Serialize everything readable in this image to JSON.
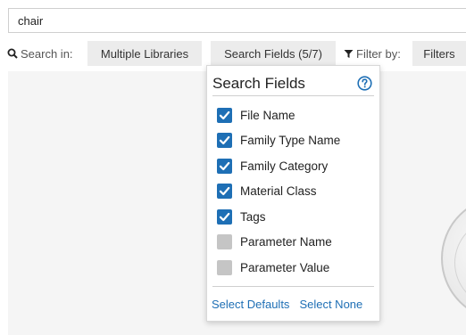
{
  "search": {
    "value": "chair"
  },
  "toolbar": {
    "search_in_label": "Search in:",
    "libraries_button": "Multiple Libraries",
    "fields_button": "Search Fields (5/7)",
    "filter_by_label": "Filter by:",
    "filters_button": "Filters"
  },
  "dropdown": {
    "title": "Search Fields",
    "items": [
      {
        "label": "File Name",
        "checked": true
      },
      {
        "label": "Family Type Name",
        "checked": true
      },
      {
        "label": "Family Category",
        "checked": true
      },
      {
        "label": "Material Class",
        "checked": true
      },
      {
        "label": "Tags",
        "checked": true
      },
      {
        "label": "Parameter Name",
        "checked": false
      },
      {
        "label": "Parameter Value",
        "checked": false
      }
    ],
    "select_defaults": "Select Defaults",
    "select_none": "Select None"
  },
  "colors": {
    "accent": "#1e6fb5",
    "unchecked": "#c5c5c5",
    "button_bg": "#ececec"
  },
  "icons": {
    "search": "search-icon",
    "filter": "filter-icon",
    "help": "help-icon",
    "check": "check-icon"
  }
}
